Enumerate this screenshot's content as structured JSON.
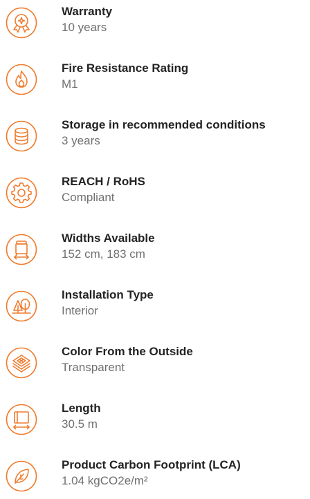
{
  "accent_color": "#F07C2E",
  "specs": [
    {
      "icon": "warranty-badge-icon",
      "label": "Warranty",
      "value": "10 years"
    },
    {
      "icon": "fire-icon",
      "label": "Fire Resistance Rating",
      "value": "M1"
    },
    {
      "icon": "database-icon",
      "label": "Storage in recommended conditions",
      "value": "3 years"
    },
    {
      "icon": "gear-icon",
      "label": "REACH / RoHS",
      "value": "Compliant"
    },
    {
      "icon": "roll-width-icon",
      "label": "Widths Available",
      "value": "152 cm, 183 cm"
    },
    {
      "icon": "tree-icon",
      "label": "Installation Type",
      "value": "Interior"
    },
    {
      "icon": "layers-icon",
      "label": "Color From the Outside",
      "value": "Transparent"
    },
    {
      "icon": "length-icon",
      "label": "Length",
      "value": "30.5 m"
    },
    {
      "icon": "leaf-icon",
      "label": "Product Carbon Footprint (LCA)",
      "value": "1.04 kgCO2e/m²"
    }
  ]
}
